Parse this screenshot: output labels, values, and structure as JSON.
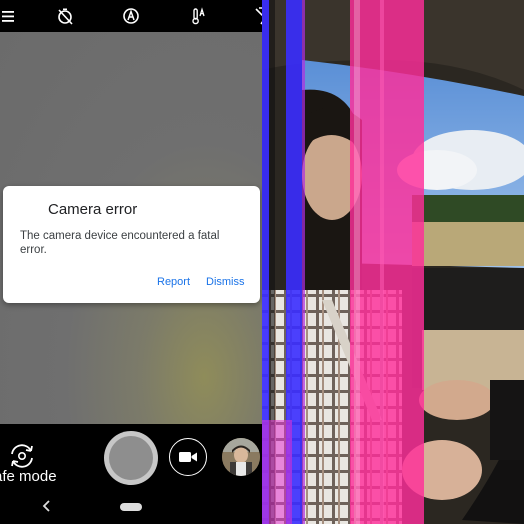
{
  "dialog": {
    "title": "Camera error",
    "message": "The camera device encountered a fatal error.",
    "report_label": "Report",
    "dismiss_label": "Dismiss"
  },
  "mode": {
    "label": "afe mode"
  },
  "icons": {
    "top": [
      "menu-icon",
      "timer-off-icon",
      "auto-flash-icon",
      "temperature-icon",
      "flash-off-icon"
    ],
    "dialog": "warning-icon",
    "switch_camera": "switch-camera-icon",
    "video": "video-camera-icon",
    "nav_back": "chevron-left-icon"
  },
  "colors": {
    "accent": "#1a73e8",
    "glitch_magenta": "#ff2d9a",
    "glitch_blue": "#3a2dff"
  }
}
